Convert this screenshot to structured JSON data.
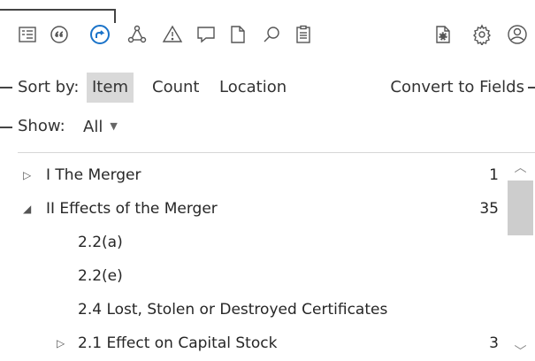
{
  "toolbar": {
    "icons": [
      {
        "name": "outline-view-icon",
        "active": false
      },
      {
        "name": "quote-icon",
        "active": false
      },
      {
        "name": "cross-reference-icon",
        "active": true
      },
      {
        "name": "relationship-icon",
        "active": false
      },
      {
        "name": "warning-icon",
        "active": false
      },
      {
        "name": "comment-icon",
        "active": false
      },
      {
        "name": "document-icon",
        "active": false
      },
      {
        "name": "search-icon",
        "active": false
      },
      {
        "name": "clipboard-icon",
        "active": false
      },
      {
        "name": "document-settings-icon",
        "active": false
      },
      {
        "name": "gear-icon",
        "active": false
      },
      {
        "name": "account-icon",
        "active": false
      }
    ],
    "accent_color": "#1a73c9"
  },
  "sort": {
    "label": "Sort by:",
    "options": [
      "Item",
      "Count",
      "Location"
    ],
    "selected": "Item",
    "convert_label": "Convert to Fields"
  },
  "show": {
    "label": "Show:",
    "value": "All"
  },
  "tree": {
    "items": [
      {
        "label": "I The Merger",
        "count": "1",
        "twisty": "collapsed"
      },
      {
        "label": "II Effects of the Merger",
        "count": "35",
        "twisty": "expanded"
      },
      {
        "label": "2.2(a)",
        "count": "",
        "twisty": "none"
      },
      {
        "label": "2.2(e)",
        "count": "",
        "twisty": "none"
      },
      {
        "label": "2.4 Lost, Stolen or Destroyed Certificates",
        "count": "",
        "twisty": "none"
      },
      {
        "label": "2.1 Effect on Capital Stock",
        "count": "3",
        "twisty": "collapsed"
      }
    ]
  }
}
